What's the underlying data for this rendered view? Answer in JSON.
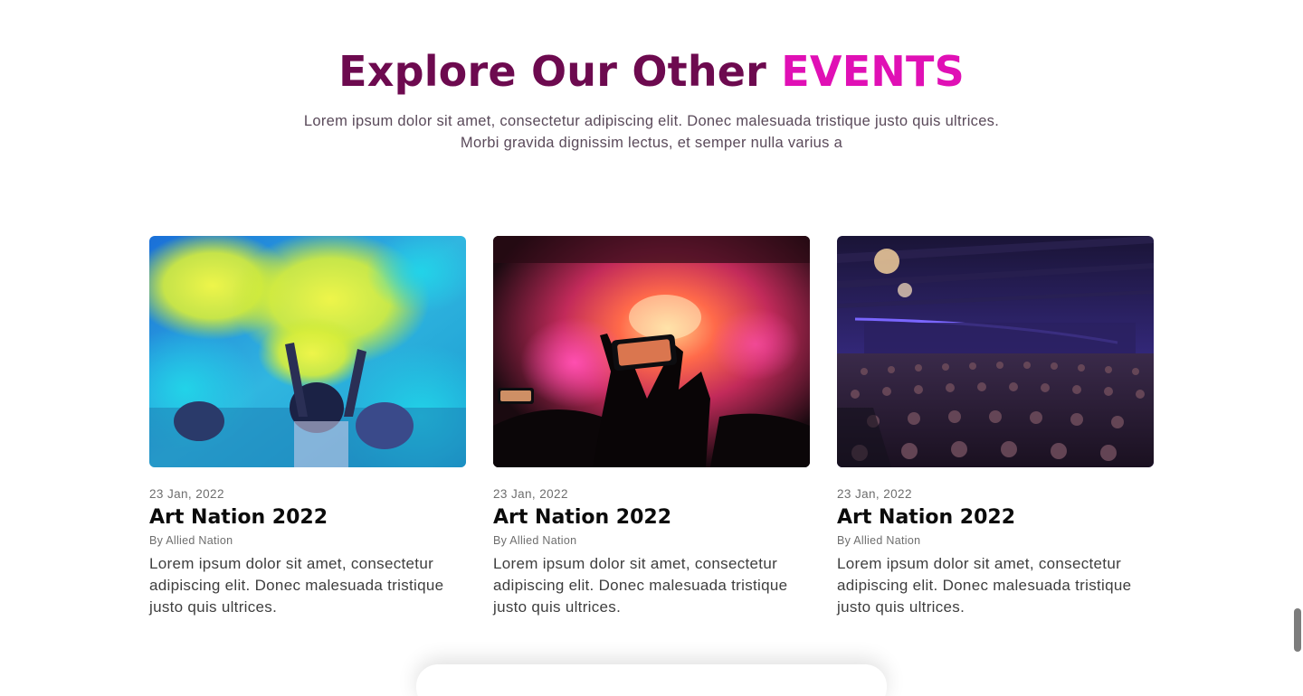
{
  "section": {
    "title_main": "Explore Our Other ",
    "title_accent": "EVENTS",
    "subtitle": "Lorem ipsum dolor sit amet, consectetur adipiscing elit. Donec malesuada tristique justo quis ultrices. Morbi gravida dignissim lectus, et semper nulla varius a"
  },
  "colors": {
    "title": "#6d0a4f",
    "accent": "#e010b5"
  },
  "events": [
    {
      "image": "holi-color-festival-photo",
      "date": "23 Jan, 2022",
      "title": "Art Nation 2022",
      "author": "By Allied Nation",
      "description": "Lorem ipsum dolor sit amet, consectetur adipiscing elit. Donec malesuada tristique justo quis ultrices."
    },
    {
      "image": "concert-phone-recording-photo",
      "date": "23 Jan, 2022",
      "title": "Art Nation 2022",
      "author": "By Allied Nation",
      "description": "Lorem ipsum dolor sit amet, consectetur adipiscing elit. Donec malesuada tristique justo quis ultrices."
    },
    {
      "image": "conference-hall-audience-photo",
      "date": "23 Jan, 2022",
      "title": "Art Nation 2022",
      "author": "By Allied Nation",
      "description": "Lorem ipsum dolor sit amet, consectetur adipiscing elit. Donec malesuada tristique justo quis ultrices."
    }
  ]
}
